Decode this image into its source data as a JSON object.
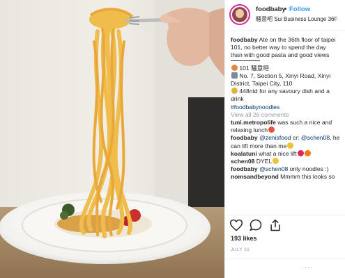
{
  "post": {
    "username": "foodbaby",
    "follow_label": "Follow",
    "separator": "•",
    "location": "騷意吧 Sui Business Lounge 36F",
    "caption_user": "foodbaby",
    "caption_lines": [
      "Ate on the 36th floor of taipei",
      "101, no better way to spend the day",
      "than with good pasta and good views"
    ],
    "info_lines": [
      "101 騷意吧",
      "No. 7, Section 5, Xinyi Road, Xinyi",
      "District, Taipei City, 110",
      "448ntd for any savoury dish and a",
      "drink"
    ],
    "hashtag": "#foodbabynoodles",
    "view_all": "View all 26 comments",
    "comments": [
      {
        "user": "tuni.metropolife",
        "text": " was such a nice and",
        "text2": "relaxing lunch"
      },
      {
        "user": "foodbaby",
        "mention": "@zenisfood",
        "mid": " cr: ",
        "mention2": "@schen08",
        "text": ", he",
        "text2": "can lift more than me"
      },
      {
        "user": "koalatuni",
        "text": " what a nice lift"
      },
      {
        "user": "schen08",
        "text": " DYEL"
      },
      {
        "user": "foodbaby",
        "mention": "@schen08",
        "text": " only noodles :)"
      },
      {
        "user": "nomsandbeyond",
        "text": " Mmmm this looks so"
      }
    ],
    "likes": "193 likes",
    "date": "JULY 31",
    "more": "···"
  },
  "icons": {
    "like": "heart-icon",
    "comment": "comment-icon",
    "share": "share-icon",
    "bookmark": "bookmark-icon"
  },
  "colors": {
    "link": "#003569",
    "follow": "#3897f0",
    "muted": "#999999"
  }
}
